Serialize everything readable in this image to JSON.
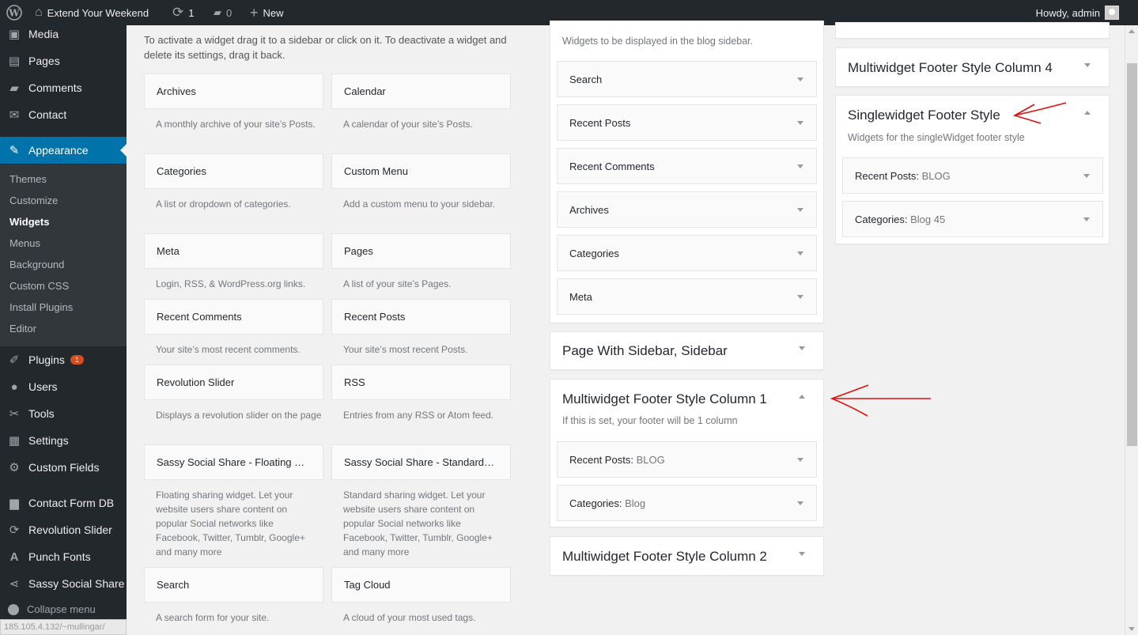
{
  "adminbar": {
    "site_name": "Extend Your Weekend",
    "updates_count": "1",
    "comments_count": "0",
    "new_label": "New",
    "howdy": "Howdy, admin"
  },
  "menu": {
    "media": "Media",
    "pages": "Pages",
    "comments": "Comments",
    "contact": "Contact",
    "appearance": "Appearance",
    "submenu": [
      "Themes",
      "Customize",
      "Widgets",
      "Menus",
      "Background",
      "Custom CSS",
      "Install Plugins",
      "Editor"
    ],
    "plugins": "Plugins",
    "plugins_badge": "1",
    "users": "Users",
    "tools": "Tools",
    "settings": "Settings",
    "custom_fields": "Custom Fields",
    "contact_form_db": "Contact Form DB",
    "revolution_slider": "Revolution Slider",
    "punch_fonts": "Punch Fonts",
    "sassy_social_share": "Sassy Social Share",
    "collapse": "Collapse menu"
  },
  "status_url": "185.105.4.132/~mullingar/",
  "available": {
    "intro": "To activate a widget drag it to a sidebar or click on it. To deactivate a widget and delete its settings, drag it back.",
    "widgets": [
      {
        "title": "Archives",
        "desc": "A monthly archive of your site’s Posts."
      },
      {
        "title": "Calendar",
        "desc": "A calendar of your site’s Posts."
      },
      {
        "title": "Categories",
        "desc": "A list or dropdown of categories."
      },
      {
        "title": "Custom Menu",
        "desc": "Add a custom menu to your sidebar."
      },
      {
        "title": "Meta",
        "desc": "Login, RSS, & WordPress.org links."
      },
      {
        "title": "Pages",
        "desc": "A list of your site’s Pages."
      },
      {
        "title": "Recent Comments",
        "desc": "Your site’s most recent comments."
      },
      {
        "title": "Recent Posts",
        "desc": "Your site’s most recent Posts."
      },
      {
        "title": "Revolution Slider",
        "desc": "Displays a revolution slider on the page"
      },
      {
        "title": "RSS",
        "desc": "Entries from any RSS or Atom feed."
      },
      {
        "title": "Sassy Social Share - Floating …",
        "desc": "Floating sharing widget. Let your website users share content on popular Social networks like Facebook, Twitter, Tumblr, Google+ and many more"
      },
      {
        "title": "Sassy Social Share - Standard…",
        "desc": "Standard sharing widget. Let your website users share content on popular Social networks like Facebook, Twitter, Tumblr, Google+ and many more"
      },
      {
        "title": "Search",
        "desc": "A search form for your site."
      },
      {
        "title": "Tag Cloud",
        "desc": "A cloud of your most used tags."
      }
    ]
  },
  "blog_sidebar": {
    "desc": "Widgets to be displayed in the blog sidebar.",
    "widgets": [
      "Search",
      "Recent Posts",
      "Recent Comments",
      "Archives",
      "Categories",
      "Meta"
    ]
  },
  "page_sidebar": {
    "title": "Page With Sidebar, Sidebar"
  },
  "footer_col1": {
    "title": "Multiwidget Footer Style Column 1",
    "desc": "If this is set, your footer will be 1 column",
    "widgets": [
      {
        "title": "Recent Posts:",
        "instance": "BLOG"
      },
      {
        "title": "Categories:",
        "instance": "Blog"
      }
    ]
  },
  "footer_col2": {
    "title": "Multiwidget Footer Style Column 2"
  },
  "footer_col4": {
    "title": "Multiwidget Footer Style Column 4"
  },
  "single_footer": {
    "title": "Singlewidget Footer Style",
    "desc": "Widgets for the singleWidget footer style",
    "widgets": [
      {
        "title": "Recent Posts:",
        "instance": "BLOG"
      },
      {
        "title": "Categories:",
        "instance": "Blog 45"
      }
    ]
  },
  "colors": {
    "accent": "#0073aa",
    "adminbar": "#23282d",
    "annotation": "#e01010",
    "badge": "#d54e21"
  }
}
